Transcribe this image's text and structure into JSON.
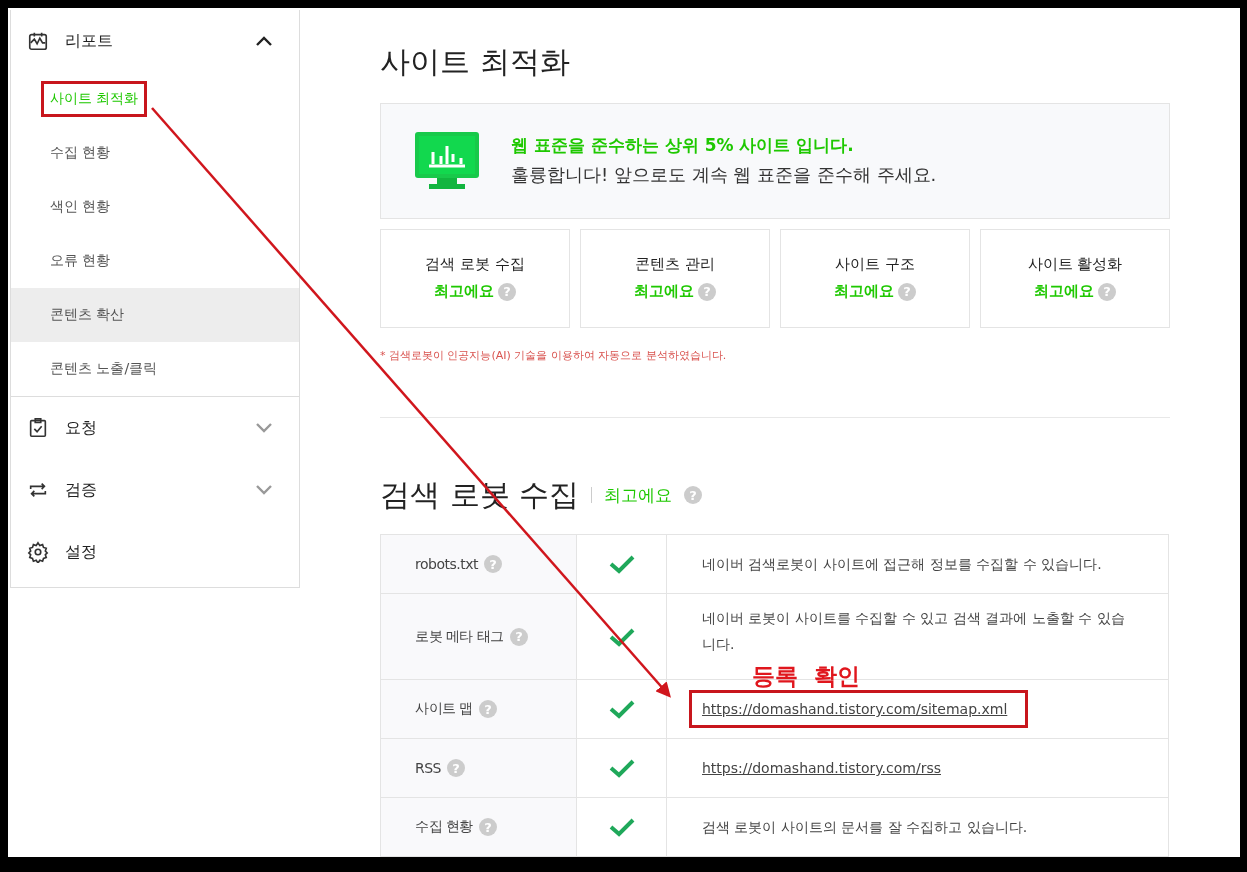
{
  "sidebar": {
    "groups": [
      {
        "label": "리포트",
        "expanded": true,
        "items": [
          {
            "label": "사이트 최적화",
            "selected": true,
            "hovered": false,
            "annotated": true
          },
          {
            "label": "수집 현황",
            "selected": false,
            "hovered": false,
            "annotated": false
          },
          {
            "label": "색인 현황",
            "selected": false,
            "hovered": false,
            "annotated": false
          },
          {
            "label": "오류 현황",
            "selected": false,
            "hovered": false,
            "annotated": false
          },
          {
            "label": "콘텐츠 확산",
            "selected": false,
            "hovered": true,
            "annotated": false
          },
          {
            "label": "콘텐츠 노출/클릭",
            "selected": false,
            "hovered": false,
            "annotated": false
          }
        ]
      },
      {
        "label": "요청",
        "expanded": false
      },
      {
        "label": "검증",
        "expanded": false
      },
      {
        "label": "설정"
      }
    ]
  },
  "page": {
    "title": "사이트 최적화",
    "banner": {
      "headline": "웹 표준을 준수하는 상위 5% 사이트 입니다.",
      "message": "훌륭합니다! 앞으로도 계속 웹 표준을 준수해 주세요."
    },
    "cards": [
      {
        "title": "검색 로봇 수집",
        "grade": "최고에요",
        "help": "?"
      },
      {
        "title": "콘텐츠 관리",
        "grade": "최고에요",
        "help": "?"
      },
      {
        "title": "사이트 구조",
        "grade": "최고에요",
        "help": "?"
      },
      {
        "title": "사이트 활성화",
        "grade": "최고에요",
        "help": "?"
      }
    ],
    "note": "* 검색로봇이 인공지능(AI) 기술을 이용하여 자동으로 분석하였습니다.",
    "section": {
      "title": "검색 로봇 수집",
      "grade": "최고에요",
      "help": "?"
    },
    "rows": [
      {
        "label": "robots.txt",
        "help": "?",
        "passed": true,
        "kind": "text",
        "detail": "네이버 검색로봇이 사이트에 접근해 정보를 수집할 수 있습니다.",
        "annotated": false
      },
      {
        "label": "로봇 메타 태그",
        "help": "?",
        "passed": true,
        "kind": "text",
        "detail": "네이버 로봇이 사이트를 수집할 수 있고 검색 결과에 노출할 수 있습니다.",
        "annotated": false
      },
      {
        "label": "사이트 맵",
        "help": "?",
        "passed": true,
        "kind": "link",
        "detail": "https://domashand.tistory.com/sitemap.xml",
        "annotated": true
      },
      {
        "label": "RSS",
        "help": "?",
        "passed": true,
        "kind": "link",
        "detail": "https://domashand.tistory.com/rss",
        "annotated": false
      },
      {
        "label": "수집 현황",
        "help": "?",
        "passed": true,
        "kind": "text",
        "detail": "검색 로봇이 사이트의 문서를 잘 수집하고 있습니다.",
        "annotated": false
      }
    ]
  },
  "annotation": {
    "label": "등록  확인",
    "arrow": true
  }
}
